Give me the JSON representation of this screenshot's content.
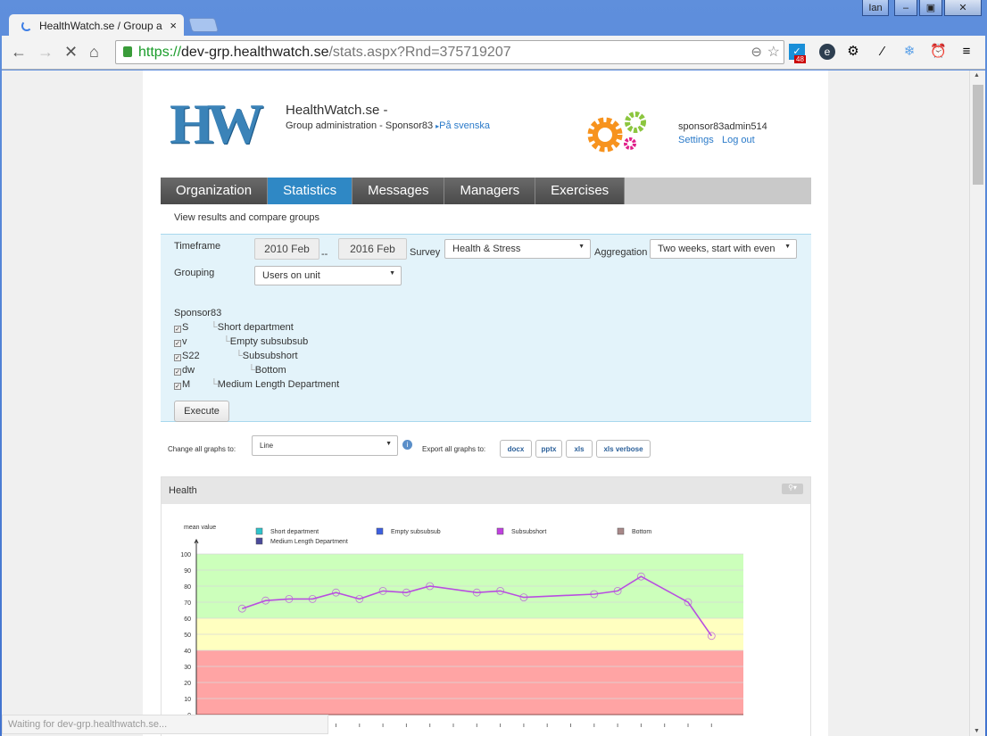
{
  "browser": {
    "tab_title": "HealthWatch.se / Group a",
    "user_badge": "Ian",
    "url_scheme": "https://",
    "url_host": "dev-grp.healthwatch.se",
    "url_path": "/stats.aspx?Rnd=375719207",
    "ext_badge": "48",
    "status_text": "Waiting for dev-grp.healthwatch.se..."
  },
  "header": {
    "logo": "HW",
    "site_title": "HealthWatch.se -",
    "subtitle": "Group administration - Sponsor83",
    "lang_link": "På svenska",
    "username": "sponsor83admin514",
    "settings": "Settings",
    "logout": "Log out"
  },
  "menu": {
    "items": [
      "Organization",
      "Statistics",
      "Messages",
      "Managers",
      "Exercises"
    ],
    "active": "Statistics"
  },
  "page_intro": "View results and compare groups",
  "filter": {
    "timeframe_label": "Timeframe",
    "from": "2010 Feb",
    "sep": "--",
    "to": "2016 Feb",
    "survey_label": "Survey",
    "survey": "Health & Stress",
    "aggregation_label": "Aggregation",
    "aggregation": "Two weeks, start with even",
    "grouping_label": "Grouping",
    "grouping": "Users on unit",
    "root": "Sponsor83",
    "units": [
      {
        "code": "S",
        "name": "Short department",
        "checked": true
      },
      {
        "code": "v",
        "name": "Empty subsubsub",
        "checked": true
      },
      {
        "code": "S22",
        "name": "Subsubshort",
        "checked": true
      },
      {
        "code": "dw",
        "name": "Bottom",
        "checked": true
      },
      {
        "code": "M",
        "name": "Medium Length Department",
        "checked": true
      }
    ],
    "execute": "Execute"
  },
  "graphs": {
    "change_label": "Change all graphs to:",
    "graph_type": "Line",
    "export_label": "Export all graphs to:",
    "exports": [
      "docx",
      "pptx",
      "xls",
      "xls verbose"
    ]
  },
  "panel": {
    "title": "Health"
  },
  "chart_data": {
    "type": "line",
    "ylabel": "mean value",
    "ylim": [
      0,
      100
    ],
    "yticks": [
      0,
      10,
      20,
      30,
      40,
      50,
      60,
      70,
      80,
      90,
      100
    ],
    "bands": [
      {
        "from": 0,
        "to": 40,
        "color": "#ffa4a4"
      },
      {
        "from": 40,
        "to": 60,
        "color": "#ffffc0"
      },
      {
        "from": 60,
        "to": 100,
        "color": "#ccffbb"
      }
    ],
    "legend": [
      {
        "name": "Short department",
        "color": "#2ec4cc"
      },
      {
        "name": "Empty subsubsub",
        "color": "#3d5fe0"
      },
      {
        "name": "Subsubshort",
        "color": "#c040e0"
      },
      {
        "name": "Bottom",
        "color": "#a88888"
      },
      {
        "name": "Medium Length Department",
        "color": "#4a4a9a"
      }
    ],
    "x_count": 22,
    "series": [
      {
        "name": "Subsubshort",
        "color": "#b84ee0",
        "x": [
          1,
          2,
          3,
          4,
          5,
          6,
          7,
          8,
          9,
          11,
          12,
          13,
          16,
          17,
          18,
          20,
          21
        ],
        "values": [
          66,
          71,
          72,
          72,
          76,
          72,
          77,
          76,
          80,
          76,
          77,
          73,
          75,
          77,
          86,
          70,
          49
        ]
      }
    ]
  }
}
